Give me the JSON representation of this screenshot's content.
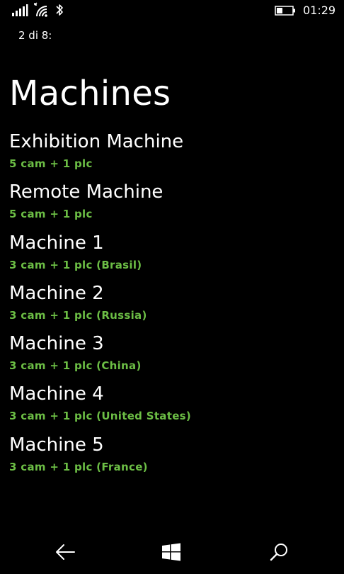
{
  "status_bar": {
    "time": "01:29",
    "icons": [
      "signal-icon",
      "wifi-icon",
      "bluetooth-icon",
      "battery-icon"
    ]
  },
  "page_indicator": "2 di 8:",
  "title": "Machines",
  "machines": [
    {
      "name": "Exhibition Machine",
      "detail": "5 cam + 1 plc"
    },
    {
      "name": "Remote Machine",
      "detail": "5 cam + 1 plc"
    },
    {
      "name": "Machine 1",
      "detail": "3 cam + 1 plc (Brasil)"
    },
    {
      "name": "Machine 2",
      "detail": "3 cam + 1 plc (Russia)"
    },
    {
      "name": "Machine 3",
      "detail": "3 cam + 1 plc (China)"
    },
    {
      "name": "Machine 4",
      "detail": "3 cam + 1 plc (United States)"
    },
    {
      "name": "Machine 5",
      "detail": "3 cam + 1 plc (France)"
    }
  ],
  "nav_bar": {
    "icons": [
      "back-arrow-icon",
      "windows-start-icon",
      "search-icon"
    ]
  },
  "colors": {
    "background": "#000000",
    "text": "#ffffff",
    "accent_green": "#6cbe45"
  }
}
